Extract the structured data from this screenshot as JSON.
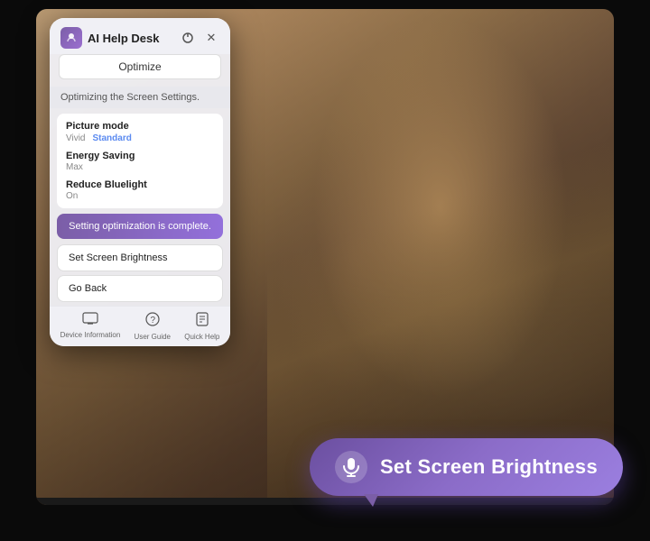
{
  "panel": {
    "title": "AI Help Desk",
    "optimize_label": "Optimize",
    "status_text": "Optimizing the Screen Settings.",
    "settings": [
      {
        "label": "Picture mode",
        "value": "Vivid",
        "alt_value": "Standard",
        "has_highlight": true
      },
      {
        "label": "Energy Saving",
        "value": "Max",
        "has_highlight": false
      },
      {
        "label": "Reduce Bluelight",
        "value": "On",
        "has_highlight": false
      }
    ],
    "complete_banner": "Setting optimization is complete.",
    "actions": [
      {
        "label": "Set Screen Brightness"
      },
      {
        "label": "Go Back"
      }
    ],
    "footer": [
      {
        "label": "Device Information",
        "icon": "▬"
      },
      {
        "label": "User Guide",
        "icon": "?"
      },
      {
        "label": "Quick Help",
        "icon": "⬜"
      }
    ]
  },
  "voice_bubble": {
    "text": "Set Screen Brightness",
    "mic_symbol": "🎤"
  },
  "icons": {
    "power": "⏻",
    "close": "✕",
    "ai_face": "◉"
  }
}
